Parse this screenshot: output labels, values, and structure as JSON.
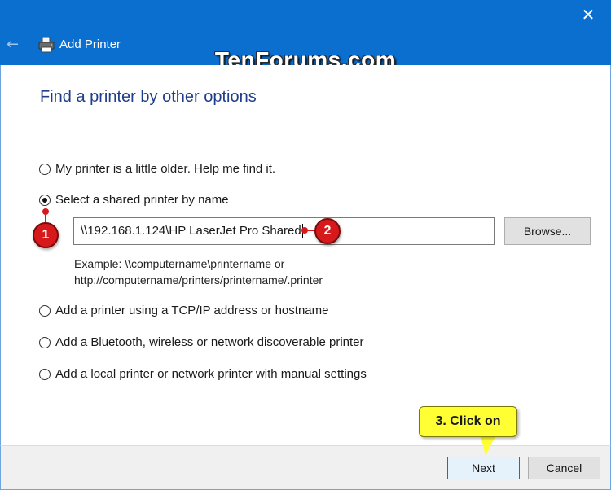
{
  "window": {
    "title": "Add Printer",
    "close_glyph": "✕",
    "back_glyph": "←",
    "icons": {
      "back": "back-arrow-icon",
      "printer": "printer-icon",
      "close": "close-icon"
    }
  },
  "watermark": "TenForums.com",
  "heading": "Find a printer by other options",
  "options": [
    {
      "label": "My printer is a little older. Help me find it.",
      "checked": false
    },
    {
      "label": "Select a shared printer by name",
      "checked": true
    },
    {
      "label": "Add a printer using a TCP/IP address or hostname",
      "checked": false
    },
    {
      "label": "Add a Bluetooth, wireless or network discoverable printer",
      "checked": false
    },
    {
      "label": "Add a local printer or network printer with manual settings",
      "checked": false
    }
  ],
  "printer_name_input": {
    "value": "\\\\192.168.1.124\\HP LaserJet Pro Shared"
  },
  "browse_label": "Browse...",
  "example": {
    "line1": "Example: \\\\computername\\printername or",
    "line2": "http://computername/printers/printername/.printer"
  },
  "buttons": {
    "next": "Next",
    "cancel": "Cancel"
  },
  "annotations": {
    "marker1": "1",
    "marker2": "2",
    "callout": "3. Click on"
  },
  "colors": {
    "titlebar": "#0b6fd0",
    "heading": "#203d8c",
    "marker": "#d7191c",
    "callout": "#ffff33",
    "next_border": "#0078d7"
  }
}
